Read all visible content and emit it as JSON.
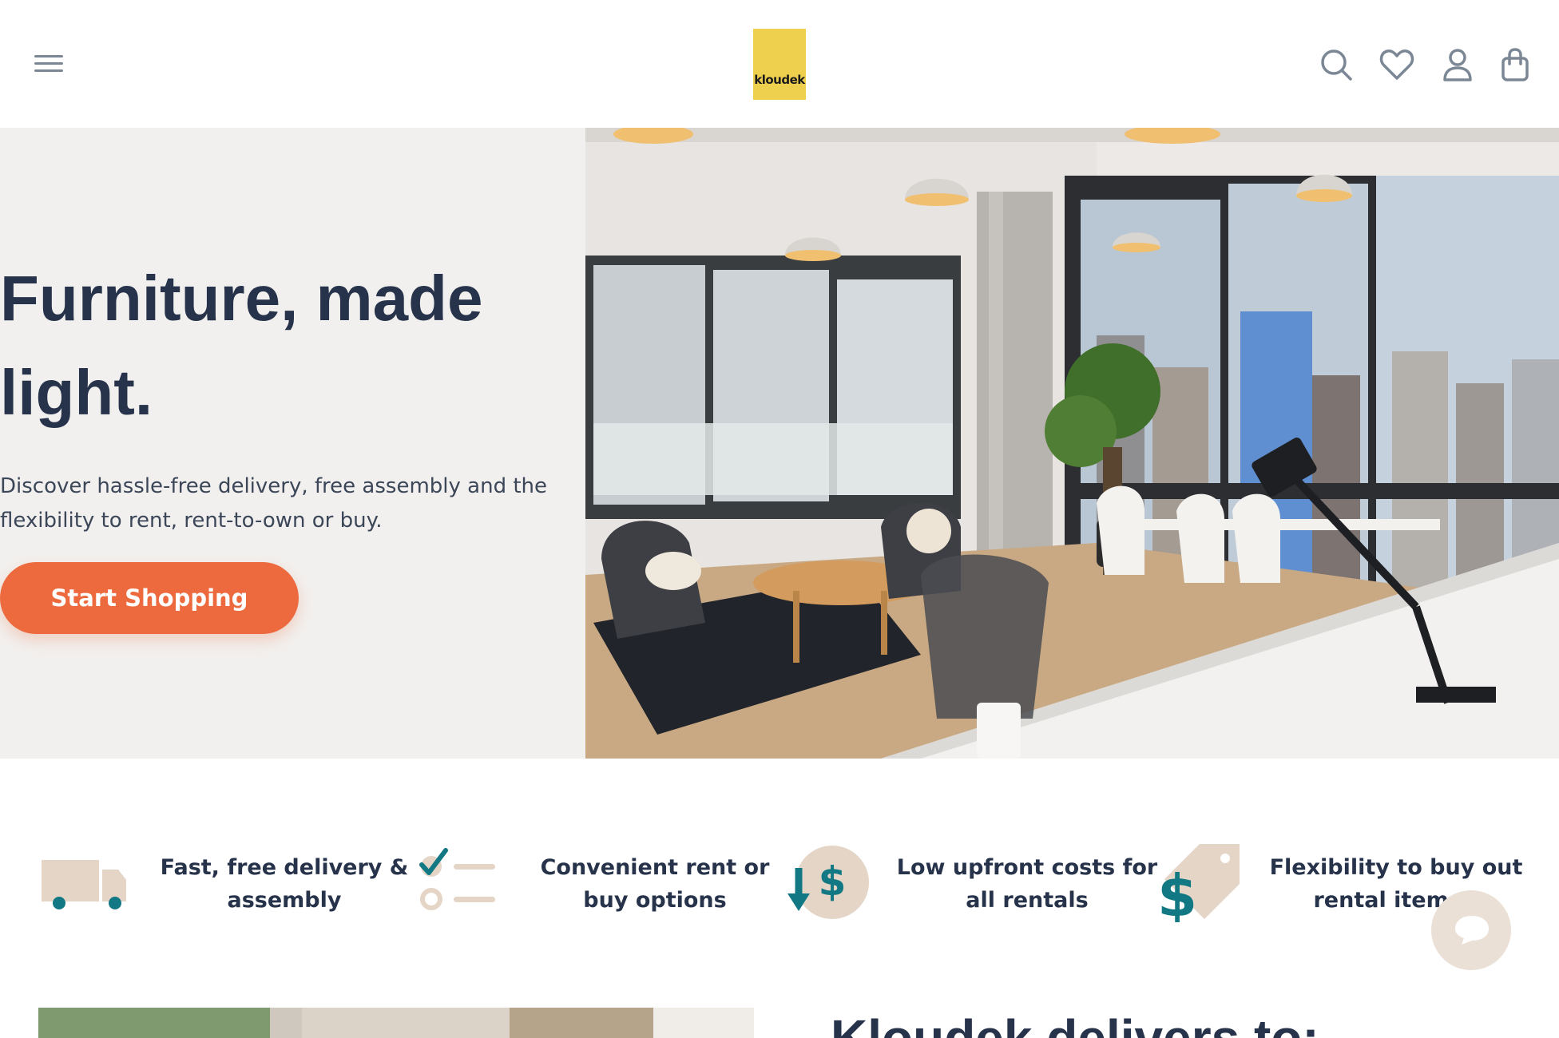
{
  "header": {
    "logo_text": "kloudek",
    "icons": [
      "menu-icon",
      "search-icon",
      "heart-icon",
      "user-icon",
      "bag-icon"
    ]
  },
  "hero": {
    "title": "Furniture, made light.",
    "subtitle": "Discover hassle-free delivery, free assembly and the flexibility to rent, rent-to-own or buy.",
    "cta_label": "Start Shopping"
  },
  "features": [
    {
      "icon": "truck-icon",
      "text": "Fast, free delivery & assembly"
    },
    {
      "icon": "checklist-icon",
      "text": "Convenient rent or buy options"
    },
    {
      "icon": "down-dollar-icon",
      "text": "Low upfront costs for all rentals"
    },
    {
      "icon": "price-tag-icon",
      "text": "Flexibility to buy out rental items !"
    }
  ],
  "delivers": {
    "title": "Kloudek delivers to:"
  },
  "colors": {
    "accent": "#ec6a3d",
    "logo": "#efd04e",
    "teal": "#127883",
    "beige": "#e4d5c7",
    "heading": "#27334a"
  }
}
